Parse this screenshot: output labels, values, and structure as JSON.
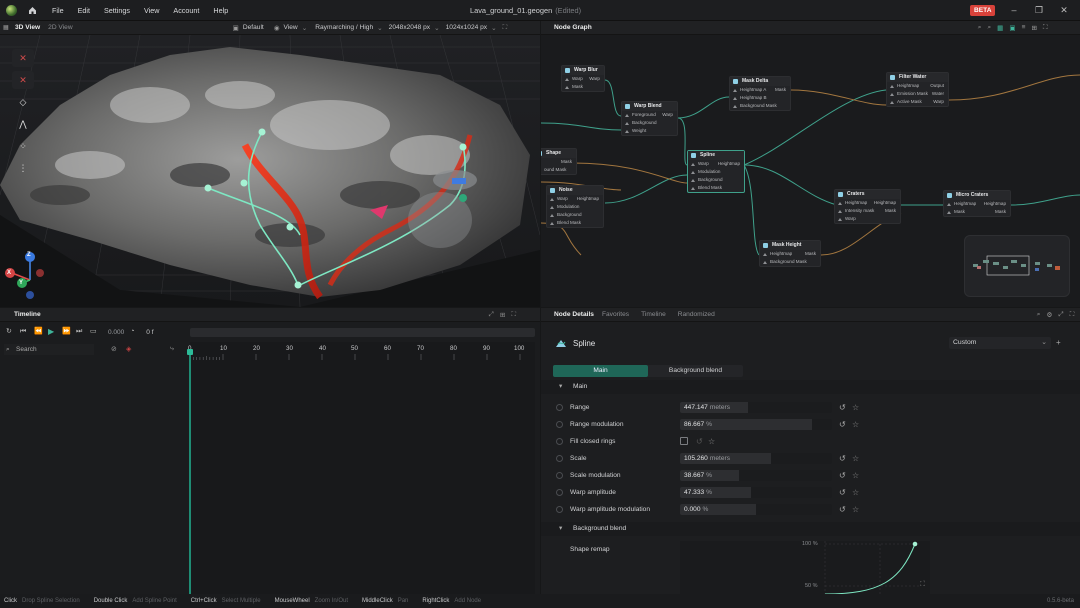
{
  "menu": [
    "File",
    "Edit",
    "Settings",
    "View",
    "Account",
    "Help"
  ],
  "window": {
    "title": "Lava_ground_01.geogen",
    "edited": "(Edited)",
    "badge": "BETA"
  },
  "view3d": {
    "tabs": [
      "3D View",
      "2D View"
    ],
    "camera": "Default",
    "view": "View",
    "quality": "Raymarching / High",
    "res1": "2048x2048 px",
    "res2": "1024x1024 px",
    "axis_labels": [
      "Z",
      "Y",
      "X"
    ]
  },
  "nodegraph": {
    "tab": "Node Graph",
    "nodes": [
      {
        "title": "Warp Blur",
        "rows": [
          [
            "Warp",
            "Warp"
          ],
          [
            "Mask",
            ""
          ]
        ]
      },
      {
        "title": "Warp Blend",
        "rows": [
          [
            "Foreground",
            "Warp"
          ],
          [
            "Background",
            ""
          ],
          [
            "Weight",
            ""
          ]
        ]
      },
      {
        "title": "Mask Delta",
        "rows": [
          [
            "Heightmap A",
            "Mask"
          ],
          [
            "Heightmap B",
            ""
          ],
          [
            "Background Mask",
            ""
          ]
        ]
      },
      {
        "title": "Filter Water",
        "rows": [
          [
            "Heightmap",
            "Output"
          ],
          [
            "Emission Mask",
            "Water"
          ],
          [
            "Active Mask",
            "Warp"
          ]
        ]
      },
      {
        "title": "Shape",
        "rows": [
          [
            "",
            "Mask"
          ],
          [
            "ound Mask",
            ""
          ]
        ]
      },
      {
        "title": "Noise",
        "rows": [
          [
            "Warp",
            "Heightmap"
          ],
          [
            "Modulation",
            ""
          ],
          [
            "Background",
            ""
          ],
          [
            "Blend Mask",
            ""
          ]
        ]
      },
      {
        "title": "Spline",
        "rows": [
          [
            "Warp",
            "Heightmap"
          ],
          [
            "Modulation",
            ""
          ],
          [
            "Background",
            ""
          ],
          [
            "Blend Mask",
            ""
          ]
        ]
      },
      {
        "title": "Craters",
        "rows": [
          [
            "Heightmap",
            "Heightmap"
          ],
          [
            "Intensity mask",
            "Mask"
          ],
          [
            "Warp",
            ""
          ]
        ]
      },
      {
        "title": "Micro Craters",
        "rows": [
          [
            "Heightmap",
            "Heightmap"
          ],
          [
            "Mask",
            "Mask"
          ]
        ]
      },
      {
        "title": "Mask Height",
        "rows": [
          [
            "Heightmap",
            "Mask"
          ],
          [
            "Background Mask",
            ""
          ]
        ]
      }
    ]
  },
  "timeline": {
    "tab": "Timeline",
    "time": "0.000",
    "frame": "0 f",
    "search_placeholder": "Search",
    "ruler": [
      "0",
      "10",
      "20",
      "30",
      "40",
      "50",
      "60",
      "70",
      "80",
      "90",
      "100"
    ]
  },
  "details": {
    "tabs": [
      "Node Details",
      "Favorites",
      "Timeline",
      "Randomized"
    ],
    "node_name": "Spline",
    "preset": "Custom",
    "subtabs": [
      "Main",
      "Background blend"
    ],
    "section_main": "Main",
    "section_bg": "Background blend",
    "props": [
      {
        "label": "Range",
        "value": "447.147",
        "unit": "meters",
        "fill": 0.45
      },
      {
        "label": "Range modulation",
        "value": "86.667",
        "unit": "%",
        "fill": 0.87
      },
      {
        "label": "Fill closed rings",
        "value": "",
        "unit": "",
        "fill": 0
      },
      {
        "label": "Scale",
        "value": "105.260",
        "unit": "meters",
        "fill": 0.6
      },
      {
        "label": "Scale modulation",
        "value": "38.667",
        "unit": "%",
        "fill": 0.39
      },
      {
        "label": "Warp amplitude",
        "value": "47.333",
        "unit": "%",
        "fill": 0.47
      },
      {
        "label": "Warp amplitude modulation",
        "value": "0.000",
        "unit": "%",
        "fill": 0.5
      }
    ],
    "shape_remap": "Shape remap",
    "graph_top": "100 %",
    "graph_mid": "50 %"
  },
  "statusbar": [
    {
      "key": "Click",
      "action": "Drop Spline Selection"
    },
    {
      "key": "Double Click",
      "action": "Add Spline Point"
    },
    {
      "key": "Ctrl+Click",
      "action": "Select Multiple"
    },
    {
      "key": "MouseWheel",
      "action": "Zoom In/Out"
    },
    {
      "key": "MiddleClick",
      "action": "Pan"
    },
    {
      "key": "RightClick",
      "action": "Add Node"
    }
  ],
  "version": "0.5.6-beta"
}
